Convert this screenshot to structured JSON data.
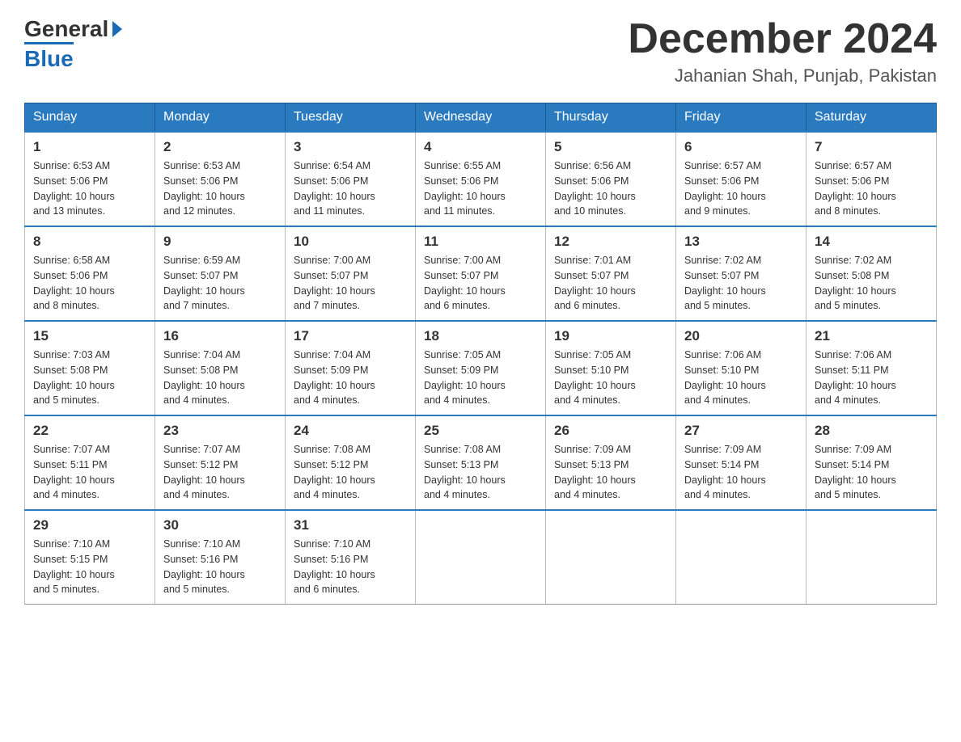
{
  "header": {
    "logo": {
      "general": "General",
      "blue": "Blue",
      "tagline": ""
    },
    "title": "December 2024",
    "location": "Jahanian Shah, Punjab, Pakistan"
  },
  "days_of_week": [
    "Sunday",
    "Monday",
    "Tuesday",
    "Wednesday",
    "Thursday",
    "Friday",
    "Saturday"
  ],
  "weeks": [
    [
      {
        "day": "1",
        "sunrise": "6:53 AM",
        "sunset": "5:06 PM",
        "daylight": "10 hours and 13 minutes."
      },
      {
        "day": "2",
        "sunrise": "6:53 AM",
        "sunset": "5:06 PM",
        "daylight": "10 hours and 12 minutes."
      },
      {
        "day": "3",
        "sunrise": "6:54 AM",
        "sunset": "5:06 PM",
        "daylight": "10 hours and 11 minutes."
      },
      {
        "day": "4",
        "sunrise": "6:55 AM",
        "sunset": "5:06 PM",
        "daylight": "10 hours and 11 minutes."
      },
      {
        "day": "5",
        "sunrise": "6:56 AM",
        "sunset": "5:06 PM",
        "daylight": "10 hours and 10 minutes."
      },
      {
        "day": "6",
        "sunrise": "6:57 AM",
        "sunset": "5:06 PM",
        "daylight": "10 hours and 9 minutes."
      },
      {
        "day": "7",
        "sunrise": "6:57 AM",
        "sunset": "5:06 PM",
        "daylight": "10 hours and 8 minutes."
      }
    ],
    [
      {
        "day": "8",
        "sunrise": "6:58 AM",
        "sunset": "5:06 PM",
        "daylight": "10 hours and 8 minutes."
      },
      {
        "day": "9",
        "sunrise": "6:59 AM",
        "sunset": "5:07 PM",
        "daylight": "10 hours and 7 minutes."
      },
      {
        "day": "10",
        "sunrise": "7:00 AM",
        "sunset": "5:07 PM",
        "daylight": "10 hours and 7 minutes."
      },
      {
        "day": "11",
        "sunrise": "7:00 AM",
        "sunset": "5:07 PM",
        "daylight": "10 hours and 6 minutes."
      },
      {
        "day": "12",
        "sunrise": "7:01 AM",
        "sunset": "5:07 PM",
        "daylight": "10 hours and 6 minutes."
      },
      {
        "day": "13",
        "sunrise": "7:02 AM",
        "sunset": "5:07 PM",
        "daylight": "10 hours and 5 minutes."
      },
      {
        "day": "14",
        "sunrise": "7:02 AM",
        "sunset": "5:08 PM",
        "daylight": "10 hours and 5 minutes."
      }
    ],
    [
      {
        "day": "15",
        "sunrise": "7:03 AM",
        "sunset": "5:08 PM",
        "daylight": "10 hours and 5 minutes."
      },
      {
        "day": "16",
        "sunrise": "7:04 AM",
        "sunset": "5:08 PM",
        "daylight": "10 hours and 4 minutes."
      },
      {
        "day": "17",
        "sunrise": "7:04 AM",
        "sunset": "5:09 PM",
        "daylight": "10 hours and 4 minutes."
      },
      {
        "day": "18",
        "sunrise": "7:05 AM",
        "sunset": "5:09 PM",
        "daylight": "10 hours and 4 minutes."
      },
      {
        "day": "19",
        "sunrise": "7:05 AM",
        "sunset": "5:10 PM",
        "daylight": "10 hours and 4 minutes."
      },
      {
        "day": "20",
        "sunrise": "7:06 AM",
        "sunset": "5:10 PM",
        "daylight": "10 hours and 4 minutes."
      },
      {
        "day": "21",
        "sunrise": "7:06 AM",
        "sunset": "5:11 PM",
        "daylight": "10 hours and 4 minutes."
      }
    ],
    [
      {
        "day": "22",
        "sunrise": "7:07 AM",
        "sunset": "5:11 PM",
        "daylight": "10 hours and 4 minutes."
      },
      {
        "day": "23",
        "sunrise": "7:07 AM",
        "sunset": "5:12 PM",
        "daylight": "10 hours and 4 minutes."
      },
      {
        "day": "24",
        "sunrise": "7:08 AM",
        "sunset": "5:12 PM",
        "daylight": "10 hours and 4 minutes."
      },
      {
        "day": "25",
        "sunrise": "7:08 AM",
        "sunset": "5:13 PM",
        "daylight": "10 hours and 4 minutes."
      },
      {
        "day": "26",
        "sunrise": "7:09 AM",
        "sunset": "5:13 PM",
        "daylight": "10 hours and 4 minutes."
      },
      {
        "day": "27",
        "sunrise": "7:09 AM",
        "sunset": "5:14 PM",
        "daylight": "10 hours and 4 minutes."
      },
      {
        "day": "28",
        "sunrise": "7:09 AM",
        "sunset": "5:14 PM",
        "daylight": "10 hours and 5 minutes."
      }
    ],
    [
      {
        "day": "29",
        "sunrise": "7:10 AM",
        "sunset": "5:15 PM",
        "daylight": "10 hours and 5 minutes."
      },
      {
        "day": "30",
        "sunrise": "7:10 AM",
        "sunset": "5:16 PM",
        "daylight": "10 hours and 5 minutes."
      },
      {
        "day": "31",
        "sunrise": "7:10 AM",
        "sunset": "5:16 PM",
        "daylight": "10 hours and 6 minutes."
      },
      null,
      null,
      null,
      null
    ]
  ],
  "labels": {
    "sunrise": "Sunrise:",
    "sunset": "Sunset:",
    "daylight": "Daylight:"
  }
}
